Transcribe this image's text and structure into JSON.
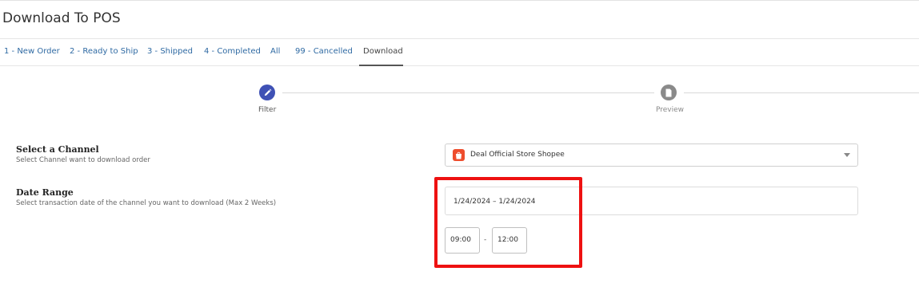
{
  "page": {
    "title": "Download To POS"
  },
  "tabs": [
    {
      "label": "1 - New Order"
    },
    {
      "label": "2 - Ready to Ship"
    },
    {
      "label": "3 - Shipped"
    },
    {
      "label": "4 - Completed"
    },
    {
      "label": "All"
    },
    {
      "label": "99 - Cancelled"
    },
    {
      "label": "Download",
      "active": true
    }
  ],
  "stepper": {
    "steps": [
      {
        "label": "Filter",
        "icon": "pencil-icon",
        "state": "active"
      },
      {
        "label": "Preview",
        "icon": "document-icon",
        "state": "inactive"
      }
    ]
  },
  "channel": {
    "title": "Select a Channel",
    "help": "Select Channel want to download order",
    "selected": "Deal Official Store Shopee",
    "icon": "shopee-icon"
  },
  "date_range": {
    "title": "Date Range",
    "help": "Select transaction date of the channel you want to download (Max 2 Weeks)",
    "value": "1/24/2024 – 1/24/2024",
    "time_start": "09:00",
    "time_separator": "-",
    "time_end": "12:00"
  },
  "colors": {
    "tab_link": "#2f6aa3",
    "step_active": "#3f51b5",
    "step_inactive": "#8a8a8a",
    "highlight": "#ee1111",
    "shopee": "#ee4d2d"
  }
}
